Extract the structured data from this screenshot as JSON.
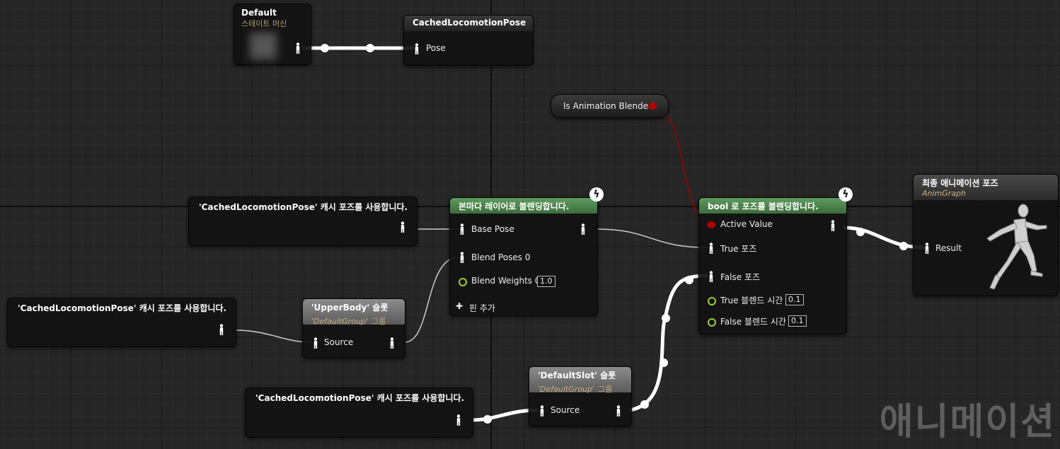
{
  "nodes": {
    "state_machine": {
      "title": "Default",
      "subtitle": "스테이트 머신"
    },
    "cached_pose_def": {
      "title": "CachedLocomotionPose",
      "pin": "Pose"
    },
    "is_blended": {
      "title": "Is Animation Blended"
    },
    "use_cached_1": {
      "title": "'CachedLocomotionPose' 캐시 포즈를 사용합니다."
    },
    "use_cached_2": {
      "title": "'CachedLocomotionPose' 캐시 포즈를 사용합니다."
    },
    "use_cached_3": {
      "title": "'CachedLocomotionPose' 캐시 포즈를 사용합니다."
    },
    "layered_blend": {
      "title": "본마다 레이어로 블렌딩합니다.",
      "base_pose": "Base Pose",
      "blend_poses": "Blend Poses 0",
      "blend_weights": "Blend Weights 0",
      "blend_weights_value": "1.0",
      "add_pin": "핀 추가"
    },
    "upper_body_slot": {
      "title": "'UpperBody' 슬롯",
      "group": "'DefaultGroup'",
      "group_suffix": "그룹",
      "pin": "Source"
    },
    "default_slot": {
      "title": "'DefaultSlot' 슬롯",
      "group": "'DefaultGroup'",
      "group_suffix": "그룹",
      "pin": "Source"
    },
    "blend_by_bool": {
      "title": "bool 로 포즈를 블렌딩합니다.",
      "active_value": "Active Value",
      "true_pose": "True 포즈",
      "false_pose": "False 포즈",
      "true_blend_time": "True 블렌드 시간",
      "true_blend_time_value": "0.1",
      "false_blend_time": "False 블렌드 시간",
      "false_blend_time_value": "0.1"
    },
    "final_pose": {
      "title": "최종 애니메이션 포즈",
      "subtitle": "AnimGraph",
      "pin": "Result"
    }
  },
  "watermark": "애니메이션",
  "icons": {
    "pose_pin": "person-icon",
    "bolt": "lightning-icon",
    "bool_pin": "red-dot-icon",
    "float_pin": "green-circle-icon",
    "add": "plus-icon"
  },
  "colors": {
    "green_header": "#4f8a4f",
    "bool_wire": "#a00000",
    "float_pin": "#9ccc3a",
    "exec_wire": "#ffffff"
  }
}
